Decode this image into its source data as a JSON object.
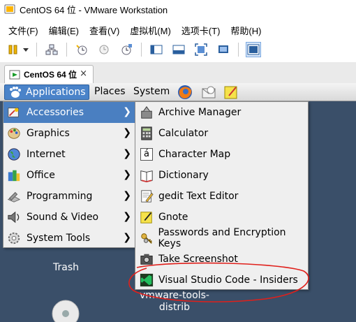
{
  "window": {
    "title": "CentOS 64 位 - VMware Workstation"
  },
  "menubar": {
    "items": [
      "文件(F)",
      "编辑(E)",
      "查看(V)",
      "虚拟机(M)",
      "选项卡(T)",
      "帮助(H)"
    ]
  },
  "toolbar": {
    "icons": [
      "pause-icon",
      "dropdown-arrow-icon",
      "network-icon",
      "snapshot-icon",
      "revert-snapshot-icon",
      "snapshot-manager-icon",
      "console-view-icon",
      "quick-switch-icon",
      "fullscreen-icon",
      "unity-icon",
      "thumbnail-view-icon"
    ]
  },
  "tab": {
    "label": "CentOS 64 位",
    "close": "×"
  },
  "panel": {
    "applications": "Applications",
    "places": "Places",
    "system": "System"
  },
  "main_menu": {
    "items": [
      {
        "label": "Accessories",
        "icon": "accessories-icon",
        "active": true
      },
      {
        "label": "Graphics",
        "icon": "graphics-icon"
      },
      {
        "label": "Internet",
        "icon": "internet-globe-icon"
      },
      {
        "label": "Office",
        "icon": "office-icon"
      },
      {
        "label": "Programming",
        "icon": "programming-icon"
      },
      {
        "label": "Sound & Video",
        "icon": "sound-video-icon"
      },
      {
        "label": "System Tools",
        "icon": "system-tools-icon"
      }
    ],
    "arrow": "❯"
  },
  "accessories_menu": {
    "items": [
      {
        "label": "Archive Manager",
        "icon": "archive-manager-icon"
      },
      {
        "label": "Calculator",
        "icon": "calculator-icon"
      },
      {
        "label": "Character Map",
        "icon": "character-map-icon"
      },
      {
        "label": "Dictionary",
        "icon": "dictionary-icon"
      },
      {
        "label": "gedit Text Editor",
        "icon": "text-editor-icon"
      },
      {
        "label": "Gnote",
        "icon": "gnote-icon"
      },
      {
        "label": "Passwords and Encryption Keys",
        "icon": "keys-icon"
      },
      {
        "label": "Take Screenshot",
        "icon": "camera-icon"
      },
      {
        "label": "Visual Studio Code - Insiders",
        "icon": "vscode-insiders-icon"
      }
    ]
  },
  "character_map_glyph": "á",
  "desktop": {
    "trash_label": "Trash",
    "vmware_label_line1": "vmware-tools-",
    "vmware_label_line2": "distrib"
  },
  "colors": {
    "selection": "#4a7fc1",
    "annotation": "#e0201b",
    "desktop": "#3a4f69"
  }
}
